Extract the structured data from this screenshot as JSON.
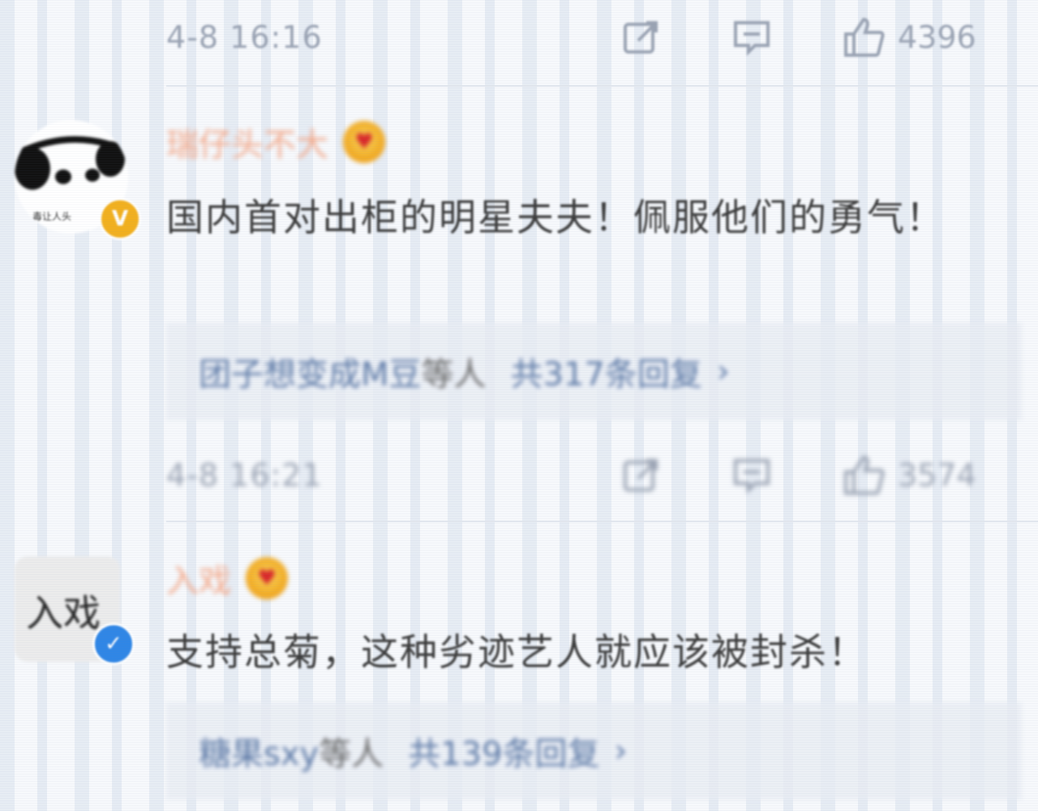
{
  "comments_top": {
    "time": "4-8 16:16",
    "like_count": "4396",
    "icons": {
      "share": "share-icon",
      "comment": "comment-icon",
      "like": "like-icon"
    }
  },
  "comment1": {
    "username": "瑞仔头不大",
    "avatar_caption": "毒让人头",
    "badge": "V",
    "text": "国内首对出柜的明星夫夫！佩服他们的勇气！",
    "reply_names": "团子想变成M豆",
    "reply_etc": "等人",
    "reply_count": "共317条回复",
    "reply_chevron": "›",
    "time": "4-8 16:21",
    "like_count": "3574"
  },
  "comment2": {
    "username": "入戏",
    "avatar_text": "入戏",
    "badge": "✓",
    "text": "支持总菊，这种劣迹艺人就应该被封杀！",
    "reply_names": "糖果sxy",
    "reply_etc": "等人",
    "reply_count": "共139条回复",
    "reply_chevron": "›"
  },
  "colors": {
    "username": "#f4a98a",
    "link": "#5b78a6",
    "meta": "#9aa3b3",
    "badge_gold": "#f2b01e",
    "badge_blue": "#2f86e6"
  }
}
